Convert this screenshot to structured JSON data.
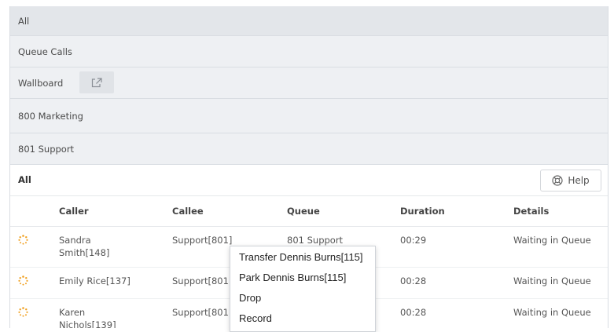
{
  "nav": {
    "items": [
      {
        "label": "All"
      },
      {
        "label": "Queue Calls"
      },
      {
        "label": "Wallboard"
      },
      {
        "label": "800 Marketing"
      },
      {
        "label": "801 Support"
      }
    ]
  },
  "section": {
    "title": "All",
    "help_label": "Help"
  },
  "table": {
    "columns": [
      "Caller",
      "Callee",
      "Queue",
      "Duration",
      "Details"
    ],
    "rows": [
      {
        "caller_line1": "Sandra",
        "caller_line2": "Smith[148]",
        "callee": "Support[801]",
        "queue": "801 Support",
        "duration": "00:29",
        "details": "Waiting in Queue"
      },
      {
        "caller_line1": "Emily Rice[137]",
        "caller_line2": "",
        "callee": "Support[801]",
        "queue": "",
        "duration": "00:28",
        "details": "Waiting in Queue"
      },
      {
        "caller_line1": "Karen",
        "caller_line2": "Nichols[139]",
        "callee": "Support[801]",
        "queue": "",
        "duration": "00:28",
        "details": "Waiting in Queue"
      }
    ]
  },
  "context_menu": {
    "items": [
      {
        "label": "Transfer Dennis Burns[115]"
      },
      {
        "label": "Park Dennis Burns[115]"
      },
      {
        "label": "Drop"
      },
      {
        "label": "Record"
      }
    ]
  },
  "colors": {
    "spinner": "#f0a020",
    "nav_bg": "#eef0f3"
  }
}
